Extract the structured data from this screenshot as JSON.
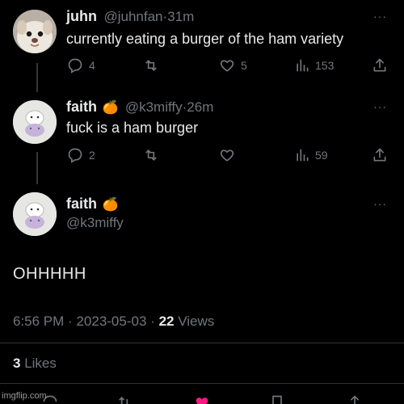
{
  "tweet1": {
    "name": "juhn",
    "handle": "@juhnfan",
    "time": "31m",
    "text": "currently eating a burger of the ham variety",
    "replies": "4",
    "likes": "5",
    "views": "153"
  },
  "tweet2": {
    "name": "faith",
    "emoji": "🍊",
    "handle": "@k3miffy",
    "time": "26m",
    "text": "fuck is a ham burger",
    "replies": "2",
    "views": "59"
  },
  "main": {
    "name": "faith",
    "emoji": "🍊",
    "handle": "@k3miffy",
    "text": "OHHHHH",
    "time": "6:56 PM",
    "date": "2023-05-03",
    "views_count": "22",
    "views_label": "Views",
    "likes_count": "3",
    "likes_label": "Likes"
  },
  "separator": "·",
  "more": "···",
  "watermark": "imgflip.com",
  "colors": {
    "bg": "#000000",
    "text": "#e7e9ea",
    "muted": "#71767b",
    "heart": "#f91880"
  }
}
